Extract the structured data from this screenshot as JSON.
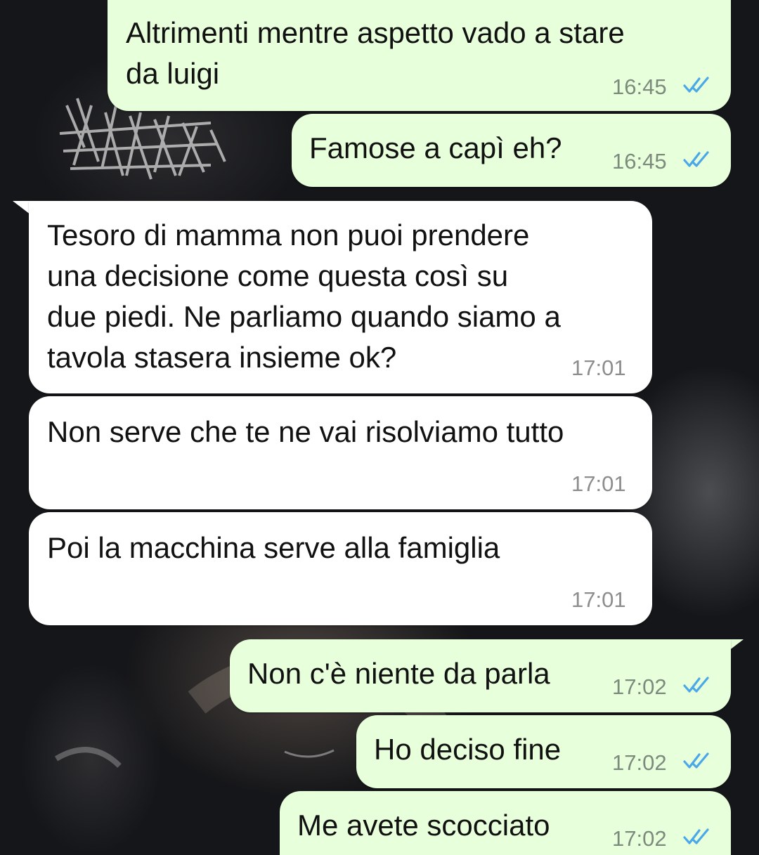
{
  "chat": {
    "messages": [
      {
        "direction": "outgoing",
        "text": "Altrimenti mentre aspetto vado a stare\nda luigi",
        "time": "16:45",
        "status_icon": "double-check-read-icon"
      },
      {
        "direction": "outgoing",
        "text": "Famose a capì eh?",
        "time": "16:45",
        "status_icon": "double-check-read-icon"
      },
      {
        "direction": "incoming",
        "text": "Tesoro di mamma non puoi prendere\nuna decisione come questa così su\ndue piedi. Ne parliamo quando siamo a\ntavola stasera insieme ok?",
        "time": "17:01"
      },
      {
        "direction": "incoming",
        "text": "Non serve che te ne vai risolviamo tutto",
        "time": "17:01"
      },
      {
        "direction": "incoming",
        "text": "Poi la macchina serve alla famiglia",
        "time": "17:01"
      },
      {
        "direction": "outgoing",
        "text": "Non c'è niente da parla",
        "time": "17:02",
        "status_icon": "double-check-read-icon"
      },
      {
        "direction": "outgoing",
        "text": "Ho deciso fine",
        "time": "17:02",
        "status_icon": "double-check-read-icon"
      },
      {
        "direction": "outgoing",
        "text": "Me avete scocciato",
        "time": "17:02",
        "status_icon": "double-check-read-icon"
      }
    ]
  },
  "colors": {
    "outgoing_bubble": "#e7ffdb",
    "incoming_bubble": "#ffffff",
    "read_ticks": "#4aa8e8",
    "background": "#151619"
  }
}
